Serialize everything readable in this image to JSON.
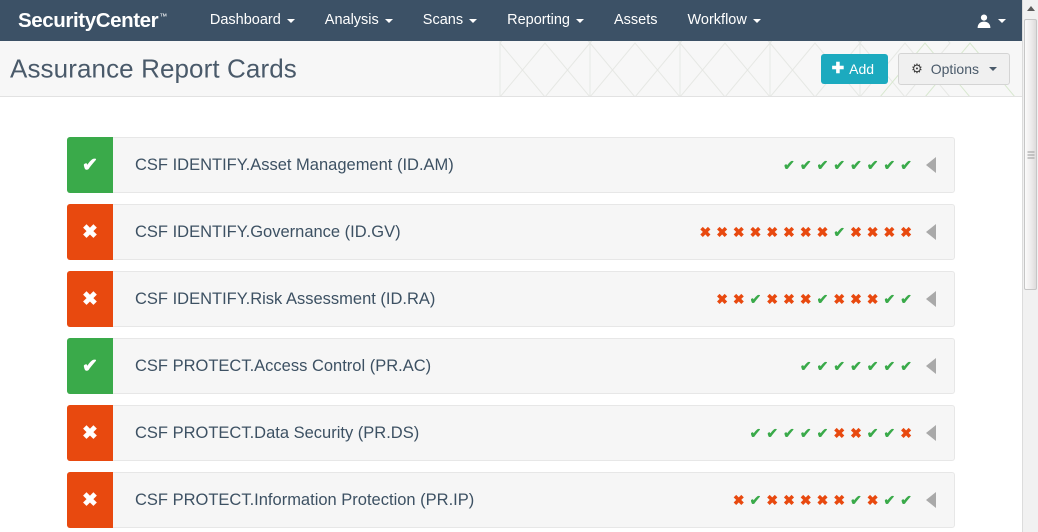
{
  "navbar": {
    "brand": "SecurityCenter",
    "brand_tm": "™",
    "items": [
      {
        "label": "Dashboard",
        "has_caret": true
      },
      {
        "label": "Analysis",
        "has_caret": true
      },
      {
        "label": "Scans",
        "has_caret": true
      },
      {
        "label": "Reporting",
        "has_caret": true
      },
      {
        "label": "Assets",
        "has_caret": false
      },
      {
        "label": "Workflow",
        "has_caret": true
      }
    ],
    "user_menu_icon": "user-icon",
    "background_color": "#3c5166"
  },
  "header": {
    "title": "Assurance Report Cards",
    "add_button": {
      "label": "Add",
      "icon": "plus-icon",
      "color": "#1caabf"
    },
    "options_button": {
      "label": "Options",
      "icon": "gear-icon",
      "caret": true
    }
  },
  "colors": {
    "pass": "#3aaa4a",
    "fail": "#e8490f",
    "accent": "#1caabf",
    "navbar": "#3c5166",
    "text": "#3d5163"
  },
  "report_cards": [
    {
      "title": "CSF IDENTIFY.Asset Management (ID.AM)",
      "status": "pass",
      "status_icon": "check-icon",
      "marks": [
        "pass",
        "pass",
        "pass",
        "pass",
        "pass",
        "pass",
        "pass",
        "pass"
      ]
    },
    {
      "title": "CSF IDENTIFY.Governance (ID.GV)",
      "status": "fail",
      "status_icon": "cross-icon",
      "marks": [
        "fail",
        "fail",
        "fail",
        "fail",
        "fail",
        "fail",
        "fail",
        "fail",
        "pass",
        "fail",
        "fail",
        "fail",
        "fail"
      ]
    },
    {
      "title": "CSF IDENTIFY.Risk Assessment (ID.RA)",
      "status": "fail",
      "status_icon": "cross-icon",
      "marks": [
        "fail",
        "fail",
        "pass",
        "fail",
        "fail",
        "fail",
        "pass",
        "fail",
        "fail",
        "fail",
        "pass",
        "pass"
      ]
    },
    {
      "title": "CSF PROTECT.Access Control (PR.AC)",
      "status": "pass",
      "status_icon": "check-icon",
      "marks": [
        "pass",
        "pass",
        "pass",
        "pass",
        "pass",
        "pass",
        "pass"
      ]
    },
    {
      "title": "CSF PROTECT.Data Security (PR.DS)",
      "status": "fail",
      "status_icon": "cross-icon",
      "marks": [
        "pass",
        "pass",
        "pass",
        "pass",
        "pass",
        "fail",
        "fail",
        "pass",
        "pass",
        "fail"
      ]
    },
    {
      "title": "CSF PROTECT.Information Protection (PR.IP)",
      "status": "fail",
      "status_icon": "cross-icon",
      "marks": [
        "fail",
        "pass",
        "fail",
        "fail",
        "fail",
        "fail",
        "fail",
        "pass",
        "fail",
        "pass",
        "pass"
      ]
    }
  ],
  "glyphs": {
    "check": "✔",
    "cross": "✖",
    "plus": "➕",
    "gear": "⚙"
  }
}
